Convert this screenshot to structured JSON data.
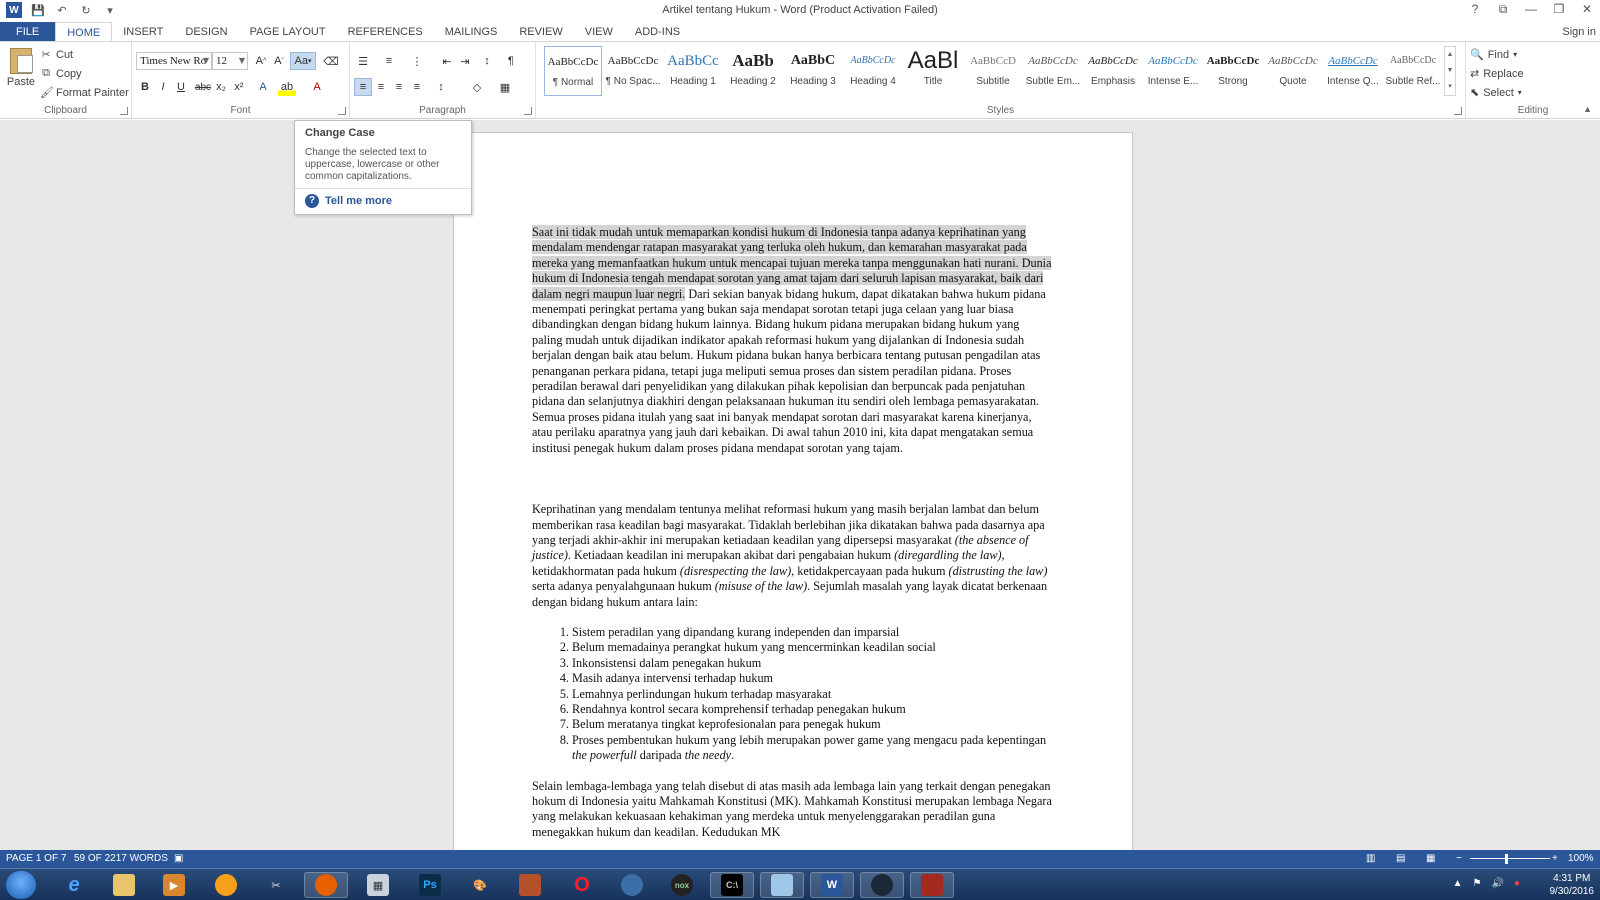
{
  "window": {
    "title": "Artikel tentang Hukum - Word (Product Activation Failed)",
    "controls": [
      "?",
      "⧉",
      "—",
      "❐",
      "✕"
    ]
  },
  "tabs": [
    "FILE",
    "HOME",
    "INSERT",
    "DESIGN",
    "PAGE LAYOUT",
    "REFERENCES",
    "MAILINGS",
    "REVIEW",
    "VIEW",
    "ADD-INS"
  ],
  "active_tab": "HOME",
  "signin": "Sign in",
  "clipboard": {
    "paste": "Paste",
    "cut": "Cut",
    "copy": "Copy",
    "format_painter": "Format Painter",
    "label": "Clipboard"
  },
  "font": {
    "name": "Times New Ro",
    "size": "12",
    "case_btn": "Aa",
    "label": "Font"
  },
  "paragraph": {
    "label": "Paragraph"
  },
  "styles": {
    "label": "Styles",
    "items": [
      {
        "preview": "AaBbCcDc",
        "name": "¶ Normal"
      },
      {
        "preview": "AaBbCcDc",
        "name": "¶ No Spac..."
      },
      {
        "preview": "AaBbCc",
        "name": "Heading 1"
      },
      {
        "preview": "AaBb",
        "name": "Heading 2"
      },
      {
        "preview": "AaBbC",
        "name": "Heading 3"
      },
      {
        "preview": "AaBbCcDc",
        "name": "Heading 4"
      },
      {
        "preview": "AaBl",
        "name": "Title"
      },
      {
        "preview": "AaBbCcD",
        "name": "Subtitle"
      },
      {
        "preview": "AaBbCcDc",
        "name": "Subtle Em..."
      },
      {
        "preview": "AaBbCcDc",
        "name": "Emphasis"
      },
      {
        "preview": "AaBbCcDc",
        "name": "Intense E..."
      },
      {
        "preview": "AaBbCcDc",
        "name": "Strong"
      },
      {
        "preview": "AaBbCcDc",
        "name": "Quote"
      },
      {
        "preview": "AaBbCcDc",
        "name": "Intense Q..."
      },
      {
        "preview": "AaBbCcDc",
        "name": "Subtle Ref..."
      }
    ]
  },
  "editing": {
    "find": "Find",
    "replace": "Replace",
    "select": "Select",
    "label": "Editing"
  },
  "tooltip": {
    "title": "Change Case",
    "desc": "Change the selected text to uppercase, lowercase or other common capitalizations.",
    "more": "Tell me more"
  },
  "document": {
    "p1_highlighted": "Saat ini tidak mudah untuk memaparkan kondisi hukum di Indonesia tanpa adanya keprihatinan yang mendalam mendengar ratapan masyarakat yang terluka oleh hukum, dan kemarahan masyarakat pada mereka yang memanfaatkan hukum untuk mencapai tujuan mereka tanpa menggunakan hati nurani. Dunia hukum di Indonesia tengah mendapat sorotan yang amat tajam dari seluruh lapisan masyarakat, baik dari dalam negri maupun luar negri.",
    "p1_rest": " Dari sekian banyak bidang hukum, dapat dikatakan bahwa hukum pidana menempati peringkat pertama yang bukan saja mendapat sorotan tetapi juga celaan yang luar biasa dibandingkan dengan bidang hukum lainnya. Bidang hukum pidana merupakan bidang hukum yang paling mudah untuk dijadikan indikator apakah reformasi hukum yang dijalankan di Indonesia sudah berjalan dengan baik atau belum. Hukum pidana bukan hanya berbicara tentang putusan pengadilan atas penanganan perkara pidana, tetapi juga meliputi semua proses dan sistem peradilan pidana. Proses peradilan berawal dari penyelidikan yang dilakukan pihak kepolisian dan berpuncak pada penjatuhan pidana dan selanjutnya diakhiri dengan pelaksanaan hukuman itu sendiri oleh lembaga pemasyarakatan. Semua proses pidana itulah yang saat ini banyak mendapat sorotan dari masyarakat karena kinerjanya, atau perilaku aparatnya yang jauh dari kebaikan. Di awal tahun 2010 ini, kita dapat mengatakan semua institusi penegak hukum dalam proses pidana mendapat sorotan yang tajam.",
    "p2_a": "Keprihatinan yang mendalam tentunya melihat reformasi hukum yang masih berjalan lambat dan belum memberikan rasa keadilan bagi masyarakat. Tidaklah berlebihan jika dikatakan bahwa pada dasarnya apa yang terjadi akhir-akhir ini merupakan ketiadaan keadilan yang dipersepsi masyarakat ",
    "p2_i1": "(the absence of justice)",
    "p2_b": ". Ketiadaan keadilan ini merupakan akibat dari pengabaian hukum ",
    "p2_i2": "(diregardling the law)",
    "p2_c": ", ketidakhormatan pada hukum ",
    "p2_i3": "(disrespecting the law)",
    "p2_d": ", ketidakpercayaan pada hukum ",
    "p2_i4": "(distrusting the law)",
    "p2_e": " serta adanya penyalahgunaan hukum ",
    "p2_i5": "(misuse of the law)",
    "p2_f": ". Sejumlah masalah yang layak dicatat berkenaan dengan bidang hukum antara lain:",
    "list": [
      "Sistem peradilan yang dipandang kurang independen dan imparsial",
      "Belum memadainya perangkat hukum yang mencerminkan keadilan social",
      "Inkonsistensi dalam penegakan hukum",
      "Masih adanya intervensi terhadap hukum",
      "Lemahnya perlindungan hukum terhadap masyarakat",
      "Rendahnya kontrol secara komprehensif terhadap penegakan hukum",
      "Belum meratanya tingkat keprofesionalan para penegak hukum"
    ],
    "list8_a": "Proses pembentukan hukum yang lebih merupakan power game yang mengacu pada kepentingan ",
    "list8_i1": "the powerfull",
    "list8_b": " daripada ",
    "list8_i2": "the needy",
    "list8_c": ".",
    "p3": "Selain lembaga-lembaga yang telah disebut di atas masih ada lembaga lain yang terkait dengan penegakan hokum di Indonesia yaitu Mahkamah Konstitusi (MK). Mahkamah Konstitusi merupakan lembaga Negara yang melakukan kekuasaan kehakiman yang merdeka untuk menyelenggarakan peradilan guna menegakkan hukum dan keadilan. Kedudukan MK"
  },
  "status": {
    "page": "PAGE 1 OF 7",
    "words": "59 OF 2217 WORDS",
    "zoom": "100%"
  },
  "taskbar": {
    "time": "4:31 PM",
    "date": "9/30/2016"
  },
  "colors": {
    "accent": "#2b579a",
    "selection": "#d4d4d4"
  }
}
